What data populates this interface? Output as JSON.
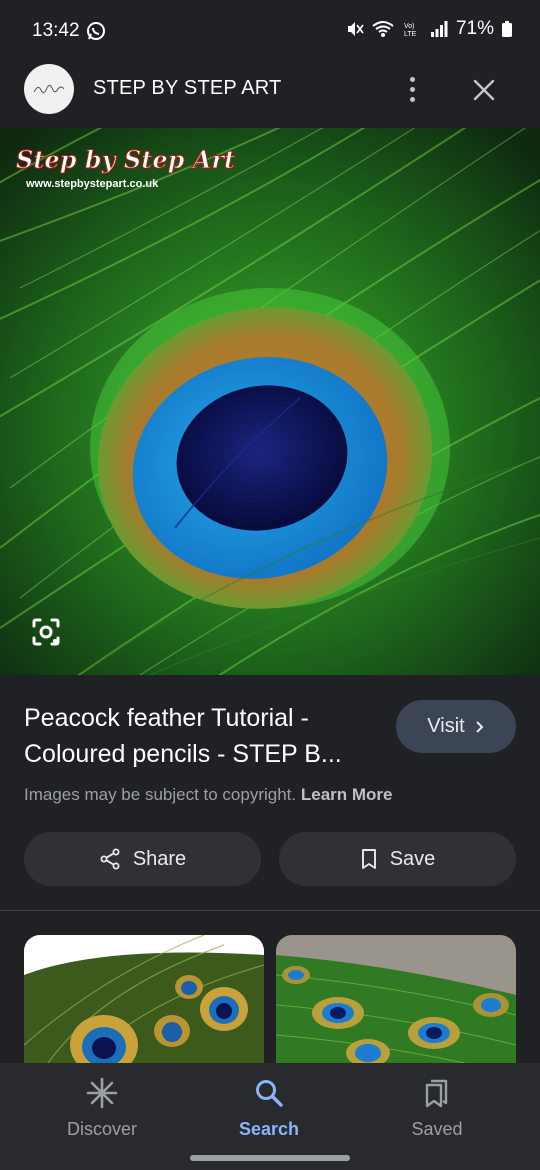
{
  "status_bar": {
    "time": "13:42",
    "battery": "71%",
    "icons": [
      "whatsapp-icon",
      "mute-icon",
      "wifi-icon",
      "volte-icon",
      "signal-icon",
      "battery-icon"
    ]
  },
  "header": {
    "site_name": "STEP BY STEP ART",
    "logo_icon": "site-logo",
    "more_icon": "more-vert-icon",
    "close_icon": "close-icon"
  },
  "hero": {
    "watermark_title": "Step by Step Art",
    "watermark_url": "www.stepbystepart.co.uk",
    "lens_icon": "google-lens-icon"
  },
  "result": {
    "title_line1": "Peacock feather Tutorial -",
    "title_line2": "Coloured pencils - STEP B...",
    "visit_label": "Visit",
    "copyright_text": "Images may be subject to copyright.",
    "learn_more": "Learn More"
  },
  "actions": {
    "share_label": "Share",
    "save_label": "Save"
  },
  "bottom_nav": {
    "items": [
      {
        "label": "Discover",
        "icon": "asterisk-icon"
      },
      {
        "label": "Search",
        "icon": "search-icon",
        "active": true
      },
      {
        "label": "Saved",
        "icon": "bookmarks-icon"
      }
    ]
  },
  "colors": {
    "background": "#202124",
    "accent": "#8ab4f8",
    "visit_button": "#3c4555",
    "pill_button": "#303134"
  }
}
